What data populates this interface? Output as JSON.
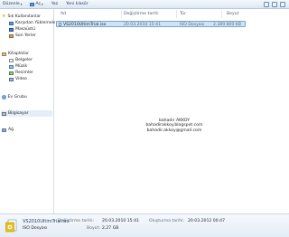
{
  "toolbar": {
    "organize": "Düzenle",
    "open": "Aç",
    "burn": "Yaz",
    "new_folder": "Yeni klasör"
  },
  "nav": {
    "favorites": "Sık Kullanılanlar",
    "downloads": "Karşıdan Yüklemeler",
    "desktop": "Masaüstü",
    "recent": "Son Yerler",
    "libraries": "Kitaplıklar",
    "documents": "Belgeler",
    "music": "Müzik",
    "pictures": "Resimler",
    "videos": "Video",
    "homegroup": "Ev Grubu",
    "computer": "Bilgisayar",
    "network": "Ağ"
  },
  "columns": {
    "name": "Ad",
    "date": "Değiştirme tarihi",
    "type": "Tür",
    "size": "Boyut"
  },
  "file": {
    "name": "VS2010UltimTrial.iso",
    "date": "20.03.2010 15:41",
    "type": "ISO Dosyası",
    "size": "2.389.800 KB"
  },
  "watermark": {
    "author": "bahadır AKKOY",
    "blog": "bahadirakkoy.blogspot.com",
    "email": "bahadir.akkoy@gmail.com"
  },
  "details": {
    "name": "VS2010UltimTrial.iso",
    "type": "ISO Dosyası",
    "mod_label": "Değiştirme tarihi:",
    "mod_value": "20.03.2010 15:41",
    "size_label": "Boyut:",
    "size_value": "2,27 GB",
    "created_label": "Oluşturma tarihi:",
    "created_value": "20.03.2012 00:47"
  }
}
